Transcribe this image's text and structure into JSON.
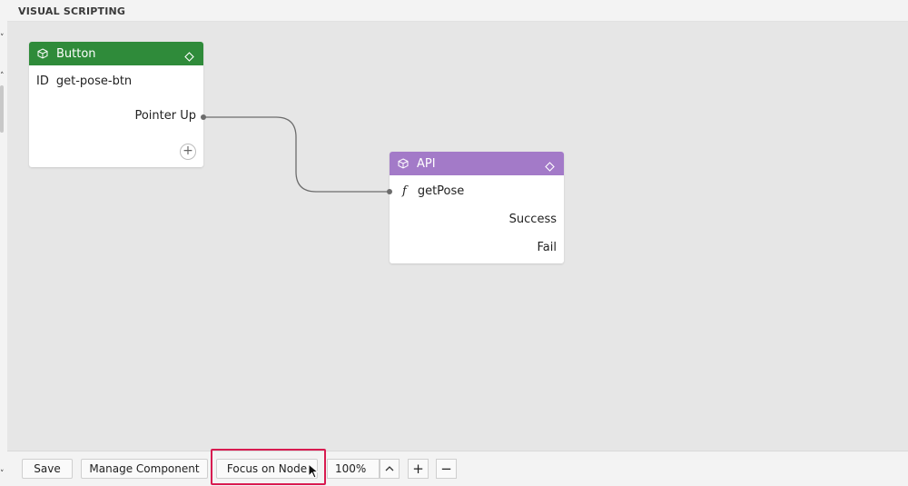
{
  "panel": {
    "title": "VISUAL SCRIPTING"
  },
  "nodes": {
    "button": {
      "title": "Button",
      "header_color": "#2f8b3a",
      "id_key": "ID",
      "id_value": "get-pose-btn",
      "output": "Pointer Up",
      "add_label": "+"
    },
    "api": {
      "title": "API",
      "header_color": "#a37ac8",
      "fn_icon": "f",
      "function": "getPose",
      "outputs": [
        "Success",
        "Fail"
      ]
    }
  },
  "toolbar": {
    "save_label": "Save",
    "manage_label": "Manage Component",
    "focus_label": "Focus on Node",
    "zoom_value": "100%",
    "zoom_up_icon": "chevron-up-icon",
    "zoom_in_label": "+",
    "zoom_out_label": "−"
  },
  "highlight_color": "#d81b50"
}
